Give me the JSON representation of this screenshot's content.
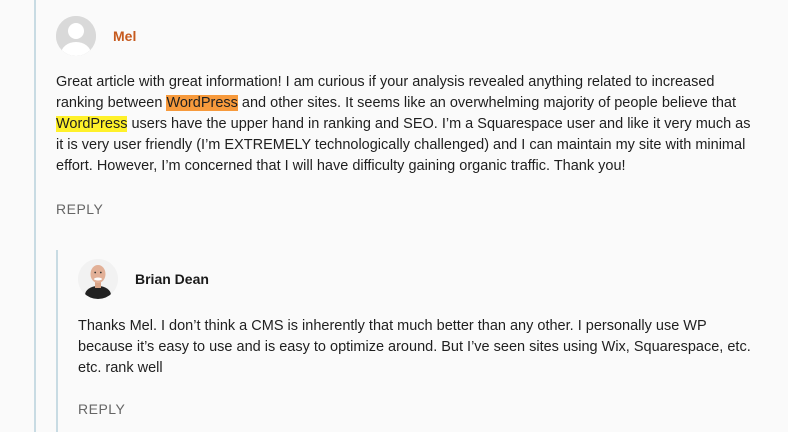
{
  "comment": {
    "author": "Mel",
    "avatar_icon": "default-user-icon",
    "body_1": "Great article with great information! I am curious if your analysis revealed anything related to increased ranking between ",
    "highlight_1": "WordPress",
    "body_2": " and other sites. It seems like an overwhelming majority of people believe that ",
    "highlight_2": "WordPress",
    "body_3": " users have the upper hand in ranking and SEO. I’m a Squarespace user and like it very much as it is very user friendly (I’m EXTREMELY technologically challenged) and I can maintain my site with minimal effort. However, I’m concerned that I will have difficulty gaining organic traffic. Thank you!",
    "reply_label": "REPLY",
    "highlight_colors": {
      "first": "#f79a3c",
      "second": "#fff12a"
    },
    "author_color": "#c65a1e"
  },
  "reply": {
    "author": "Brian Dean",
    "avatar_icon": "author-photo",
    "body": "Thanks Mel. I don’t think a CMS is inherently that much better than any other. I personally use WP because it’s easy to use and is easy to optimize around. But I’ve seen sites using Wix, Squarespace, etc. etc. rank well",
    "reply_label": "REPLY"
  },
  "thread_line_color": "#c8dbe3"
}
